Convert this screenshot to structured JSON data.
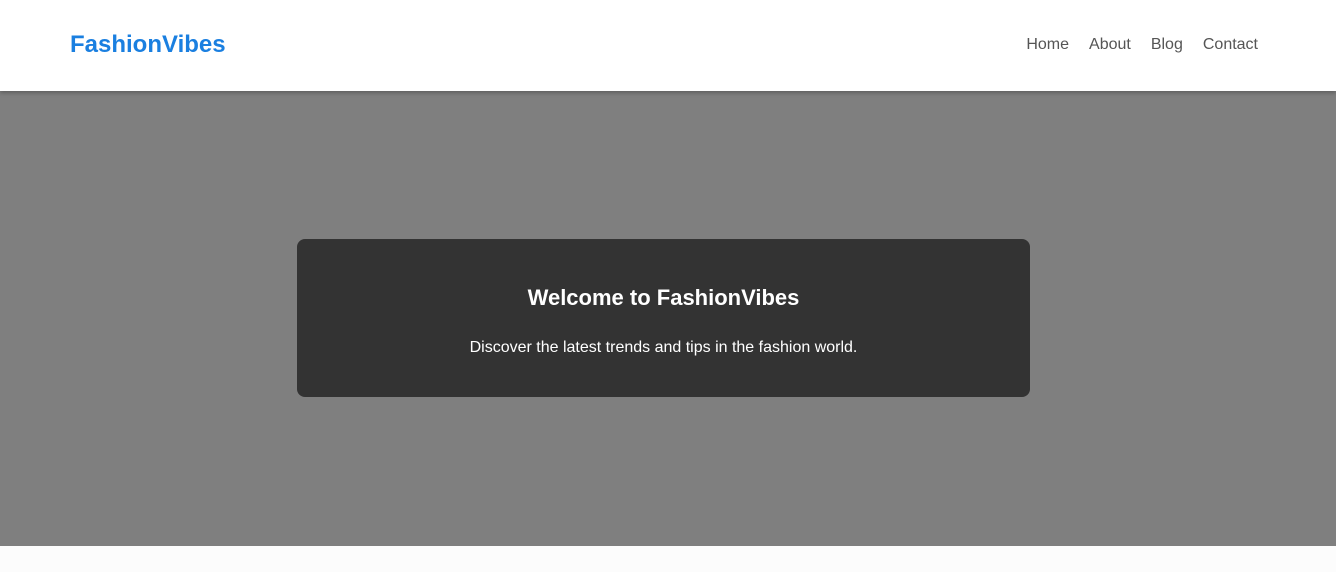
{
  "header": {
    "logo": "FashionVibes",
    "nav": [
      {
        "label": "Home"
      },
      {
        "label": "About"
      },
      {
        "label": "Blog"
      },
      {
        "label": "Contact"
      }
    ]
  },
  "hero": {
    "title": "Welcome to FashionVibes",
    "subtitle": "Discover the latest trends and tips in the fashion world."
  },
  "colors": {
    "brand": "#1a7fe0",
    "hero_background": "#7f7f7f",
    "card_background": "#333333",
    "nav_text": "#555555"
  }
}
